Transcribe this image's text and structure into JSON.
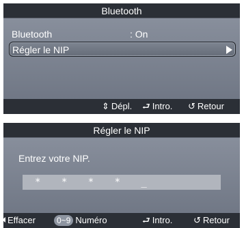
{
  "screen1": {
    "title": "Bluetooth",
    "rows": [
      {
        "label": "Bluetooth",
        "value": ": On"
      },
      {
        "label": "Régler le NIP",
        "value": ""
      }
    ],
    "footer": {
      "move_icon": "⇕",
      "move_label": "Dépl.",
      "enter_icon": "⮐",
      "enter_label": "Intro.",
      "return_icon": "↺",
      "return_label": "Retour"
    }
  },
  "screen2": {
    "title": "Régler le NIP",
    "prompt": "Entrez votre NIP.",
    "pin_value": "* * * * _",
    "footer": {
      "erase_label": "Effacer",
      "number_badge": "0~9",
      "number_label": "Numéro",
      "enter_icon": "⮐",
      "enter_label": "Intro.",
      "return_icon": "↺",
      "return_label": "Retour"
    }
  }
}
